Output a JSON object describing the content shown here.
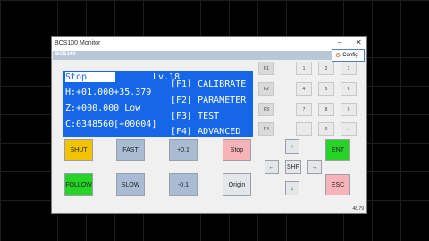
{
  "window": {
    "title": "BCS100 Monitor",
    "minimize": "–",
    "close": "✕",
    "subtitle": "BCS100",
    "config_label": "Config",
    "version": "48.79"
  },
  "lcd": {
    "line1_status": "Stop",
    "line1_level": "Lv.18",
    "line2": "H:+01.000+35.379",
    "line3": "Z:+000.000 Low",
    "line4": "C:0348560[+00004]",
    "menu1": "[F1] CALIBRATE",
    "menu2": "[F2] PARAMETER",
    "menu3": "[F3] TEST",
    "menu4": "[F4] ADVANCED"
  },
  "fkeys": [
    "F1",
    "F2",
    "F3",
    "F4"
  ],
  "keypad": [
    "1",
    "2",
    "3",
    "4",
    "5",
    "6",
    "7",
    "8",
    "9",
    "-",
    "0",
    "←"
  ],
  "buttons": {
    "shut": "SHUT",
    "fast": "FAST",
    "plus01": "+0.1",
    "stop": "Stop",
    "follow": "FOLLOW",
    "slow": "SLOW",
    "minus01": "-0.1",
    "origin": "Origin",
    "up": "↑",
    "left": "←",
    "shf": "SHF",
    "right": "→",
    "down": "↓",
    "ent": "ENT",
    "esc": "ESC"
  },
  "colors": {
    "lcd": "#1666e8",
    "shut": "#f2c300",
    "follow": "#26d426",
    "stop": "#f7b3b8"
  }
}
